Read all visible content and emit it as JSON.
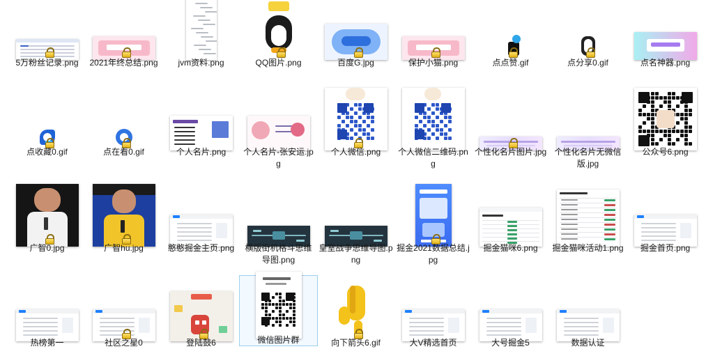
{
  "window": {
    "view": "large-icons"
  },
  "files": [
    {
      "name": "5万粉丝记录.png",
      "thumb": "doc",
      "accent": "#3a5fc8"
    },
    {
      "name": "2021年终总结.png",
      "thumb": "banner",
      "accent": "#f6a5b8"
    },
    {
      "name": "jvm资料.png",
      "thumb": "mindmap",
      "accent": "#9aa0a6"
    },
    {
      "name": "QQ图片.png",
      "thumb": "penguin",
      "accent": "#222222"
    },
    {
      "name": "百度G.jpg",
      "thumb": "baidu",
      "accent": "#2d6fdc"
    },
    {
      "name": "保护小猫.png",
      "thumb": "banner",
      "accent": "#f6a5b8"
    },
    {
      "name": "点点赞.gif",
      "thumb": "thumbsup",
      "accent": "#2fa6e9"
    },
    {
      "name": "点分享0.gif",
      "thumb": "share",
      "accent": "#333333"
    },
    {
      "name": "点名神器.png",
      "thumb": "purplebanner",
      "accent": "#a77bf0"
    },
    {
      "name": "点收藏0.gif",
      "thumb": "star",
      "accent": "#1f63d6"
    },
    {
      "name": "点在看0.gif",
      "thumb": "flower",
      "accent": "#2f74e3"
    },
    {
      "name": "个人名片.png",
      "thumb": "card",
      "accent": "#6b4aa5"
    },
    {
      "name": "个人名片-张安运.jpg",
      "thumb": "card2",
      "accent": "#f1a8b6"
    },
    {
      "name": "个人微信.png",
      "thumb": "qrblue",
      "accent": "#2d58c9"
    },
    {
      "name": "个人微信二维码.png",
      "thumb": "qrbunny",
      "accent": "#2d58c9"
    },
    {
      "name": "个性化名片图片.jpg",
      "thumb": "strip",
      "accent": "#b7a3e6"
    },
    {
      "name": "个性化名片无微信版.jpg",
      "thumb": "strip",
      "accent": "#b7a3e6"
    },
    {
      "name": "公众号6.png",
      "thumb": "qrblack",
      "accent": "#111111"
    },
    {
      "name": "广智0.jpg",
      "thumb": "photo",
      "accent": "#1a1a1a"
    },
    {
      "name": "广智hu.jpg",
      "thumb": "photo2",
      "accent": "#1d3fa0"
    },
    {
      "name": "憨憨掘金主页.png",
      "thumb": "webpage",
      "accent": "#1e80ff"
    },
    {
      "name": "横版街机格斗思维导图.png",
      "thumb": "darkmind",
      "accent": "#2f4b5c"
    },
    {
      "name": "皇室战争思维导图.png",
      "thumb": "darkmind",
      "accent": "#2f4b5c"
    },
    {
      "name": "掘金2021数据总结.jpg",
      "thumb": "juejin",
      "accent": "#3f7cf7"
    },
    {
      "name": "掘金猫咪6.png",
      "thumb": "webtable",
      "accent": "#38a169"
    },
    {
      "name": "掘金猫咪活动1.png",
      "thumb": "webtable2",
      "accent": "#c94d4d"
    },
    {
      "name": "掘金首页.png",
      "thumb": "webpage",
      "accent": "#1e80ff"
    },
    {
      "name": "热榜第一",
      "thumb": "webpage",
      "accent": "#1e80ff"
    },
    {
      "name": "社区之星0",
      "thumb": "webpage",
      "accent": "#1e80ff"
    },
    {
      "name": "登陆鼓6",
      "thumb": "game",
      "accent": "#e85d4a"
    },
    {
      "name": "微信图片群",
      "thumb": "qrdoc",
      "accent": "#111111"
    },
    {
      "name": "向下箭头6.gif",
      "thumb": "hand",
      "accent": "#f3c21b"
    },
    {
      "name": "大V精选首页",
      "thumb": "webpage",
      "accent": "#1e80ff"
    },
    {
      "name": "大号掘金5",
      "thumb": "webpage",
      "accent": "#1e80ff"
    },
    {
      "name": "数据认证",
      "thumb": "webpage",
      "accent": "#1e80ff"
    }
  ]
}
